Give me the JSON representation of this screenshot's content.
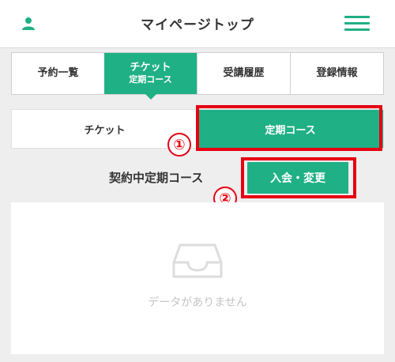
{
  "header": {
    "title": "マイページトップ",
    "user_icon": "user-icon",
    "menu_icon": "hamburger-menu-icon"
  },
  "tabs": [
    {
      "label": "予約一覧",
      "active": false
    },
    {
      "label": "チケット",
      "sub": "定期コース",
      "active": true
    },
    {
      "label": "受講履歴",
      "active": false
    },
    {
      "label": "登録情報",
      "active": false
    }
  ],
  "subtabs": [
    {
      "label": "チケット",
      "active": false
    },
    {
      "label": "定期コース",
      "active": true
    }
  ],
  "contract": {
    "label": "契約中定期コース",
    "button_label": "入会・変更"
  },
  "empty": {
    "message": "データがありません",
    "icon": "inbox-icon"
  },
  "annotations": {
    "marker_1": "①",
    "marker_2": "②"
  },
  "colors": {
    "accent": "#1fb085",
    "highlight": "#e60012",
    "muted_text": "#c4c4c4"
  }
}
